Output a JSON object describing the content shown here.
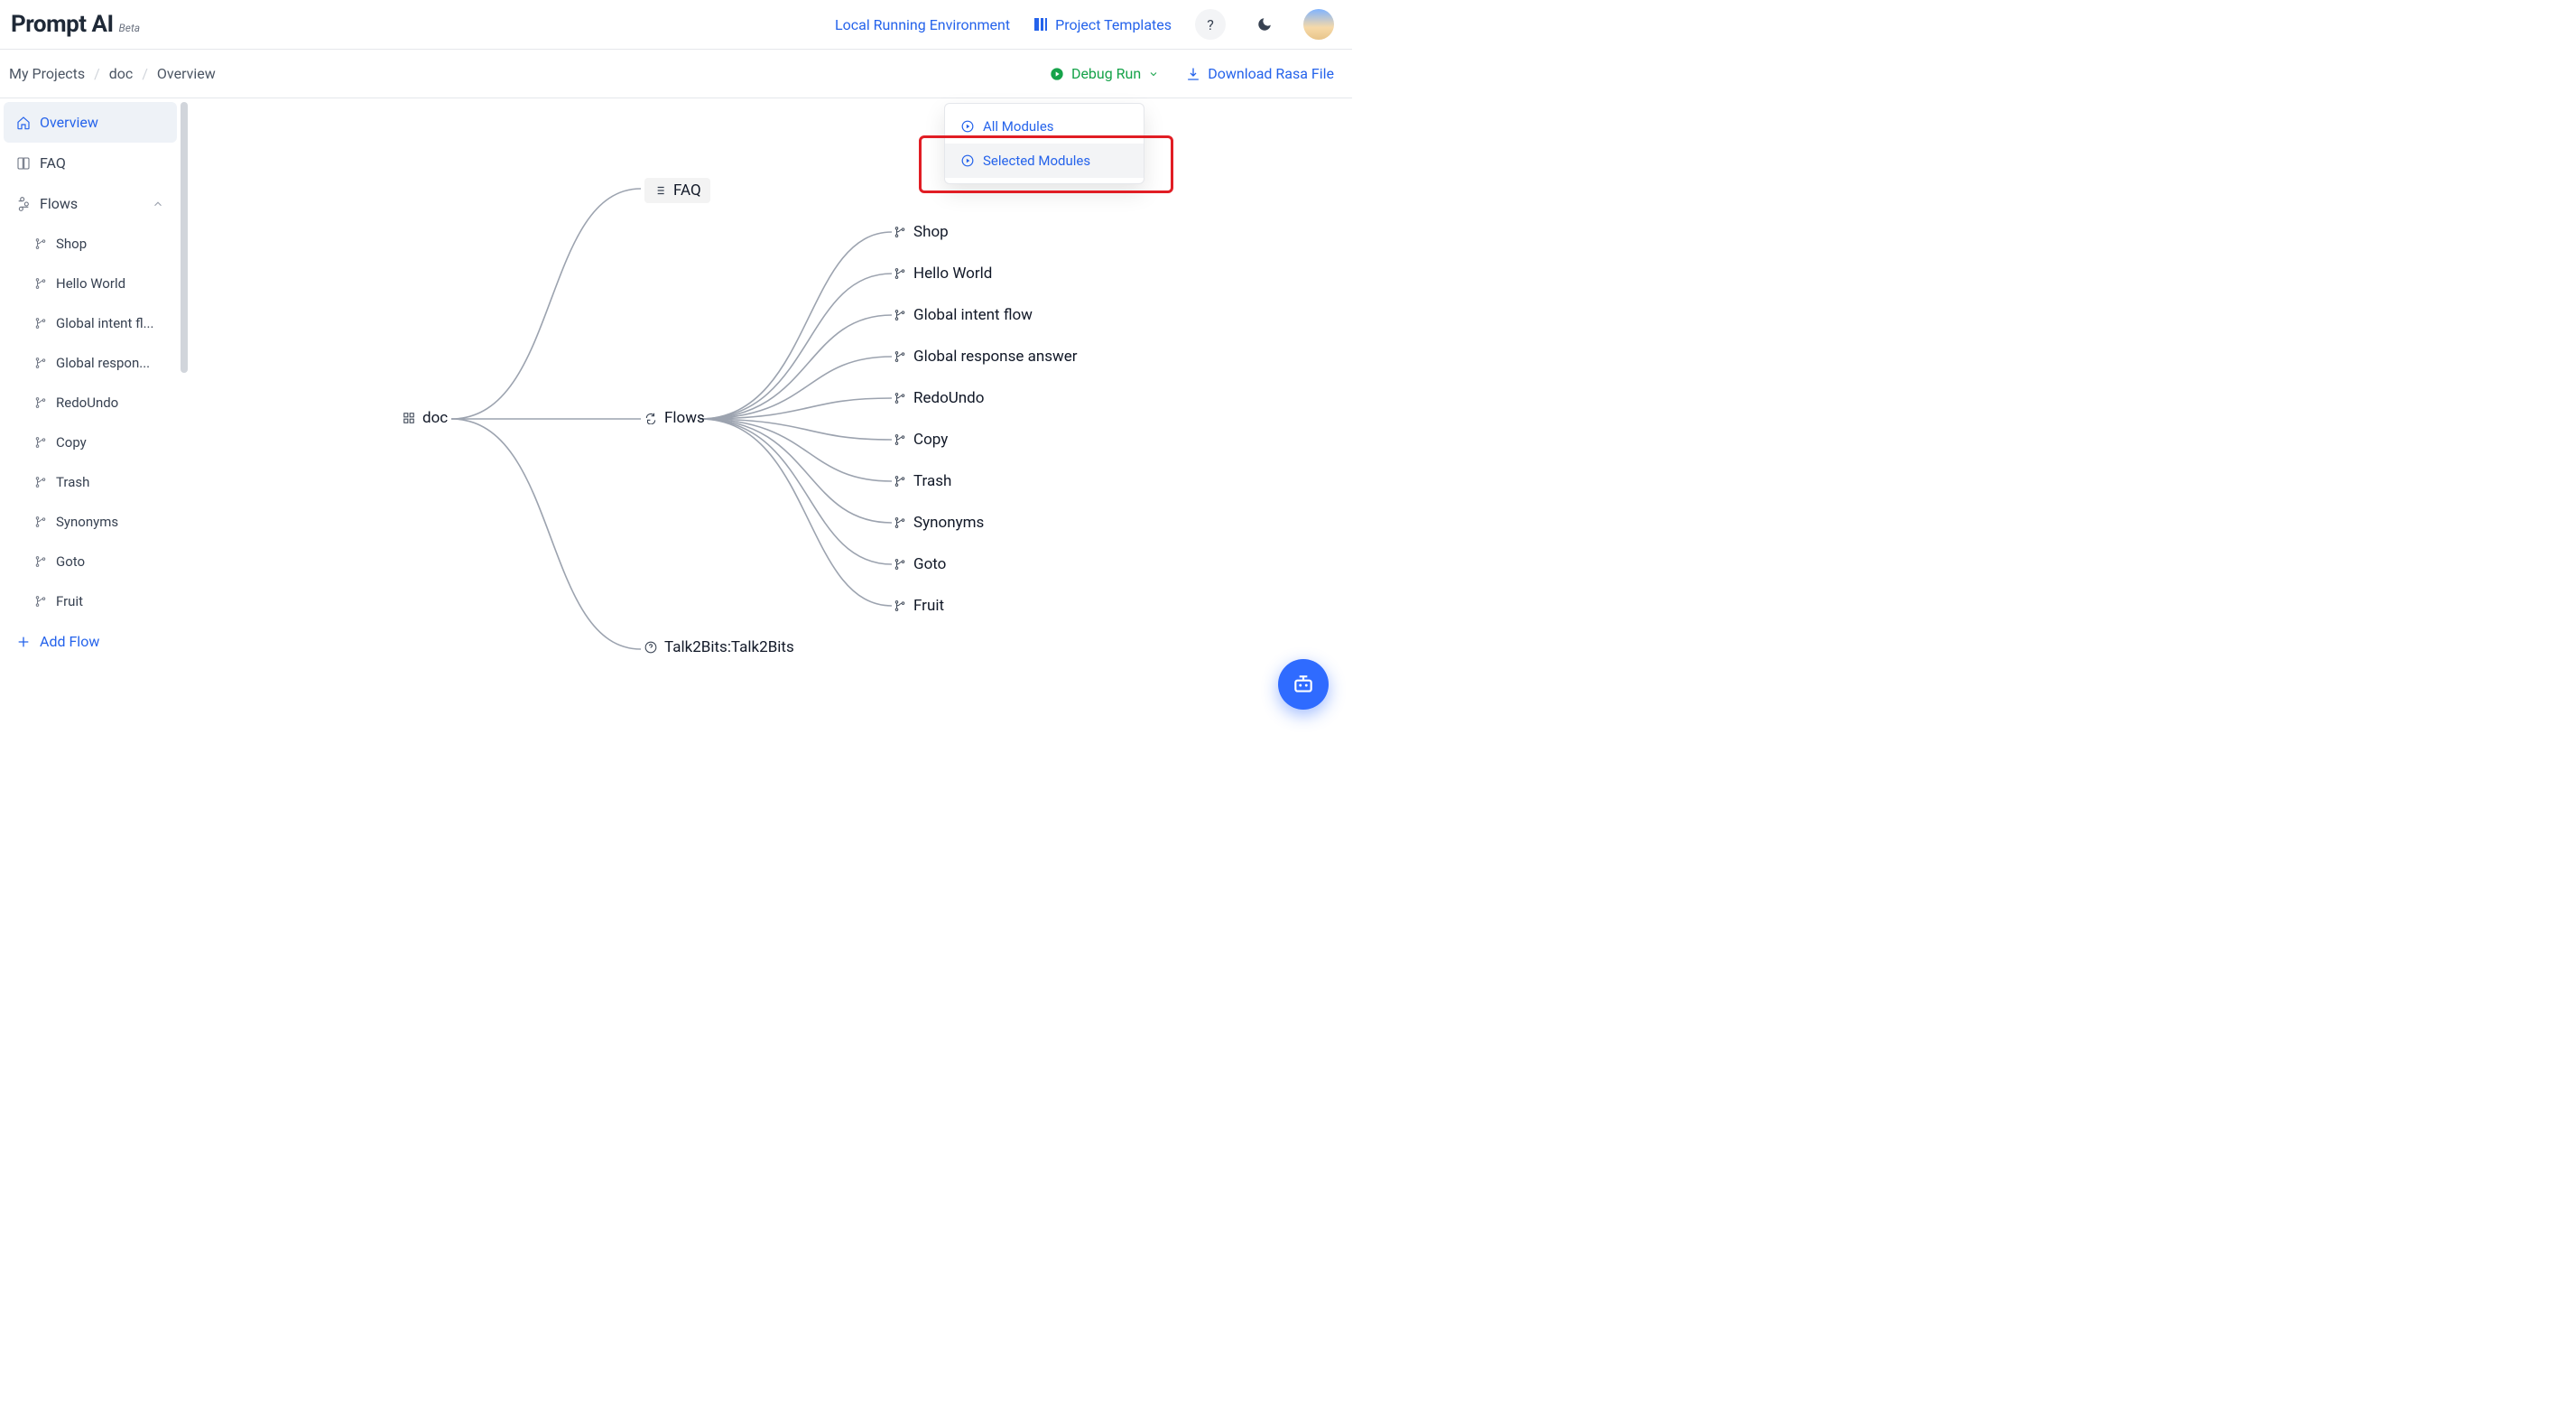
{
  "brand": {
    "name": "Prompt AI",
    "beta": "Beta"
  },
  "topbar": {
    "local_env": "Local Running Environment",
    "templates": "Project Templates"
  },
  "crumbs": {
    "root": "My Projects",
    "project": "doc",
    "page": "Overview"
  },
  "actions": {
    "debug_run": "Debug Run",
    "download": "Download Rasa File"
  },
  "run_menu": {
    "all": "All Modules",
    "selected": "Selected Modules"
  },
  "sidebar": {
    "overview": "Overview",
    "faq": "FAQ",
    "flows": "Flows",
    "items": [
      "Shop",
      "Hello World",
      "Global intent fl...",
      "Global respon...",
      "RedoUndo",
      "Copy",
      "Trash",
      "Synonyms",
      "Goto",
      "Fruit"
    ],
    "add_flow": "Add Flow"
  },
  "map": {
    "root": "doc",
    "mid": {
      "faq": "FAQ",
      "flows": "Flows",
      "talk2bits": "Talk2Bits:Talk2Bits"
    },
    "leaves": [
      "Shop",
      "Hello World",
      "Global intent flow",
      "Global response answer",
      "RedoUndo",
      "Copy",
      "Trash",
      "Synonyms",
      "Goto",
      "Fruit"
    ]
  }
}
